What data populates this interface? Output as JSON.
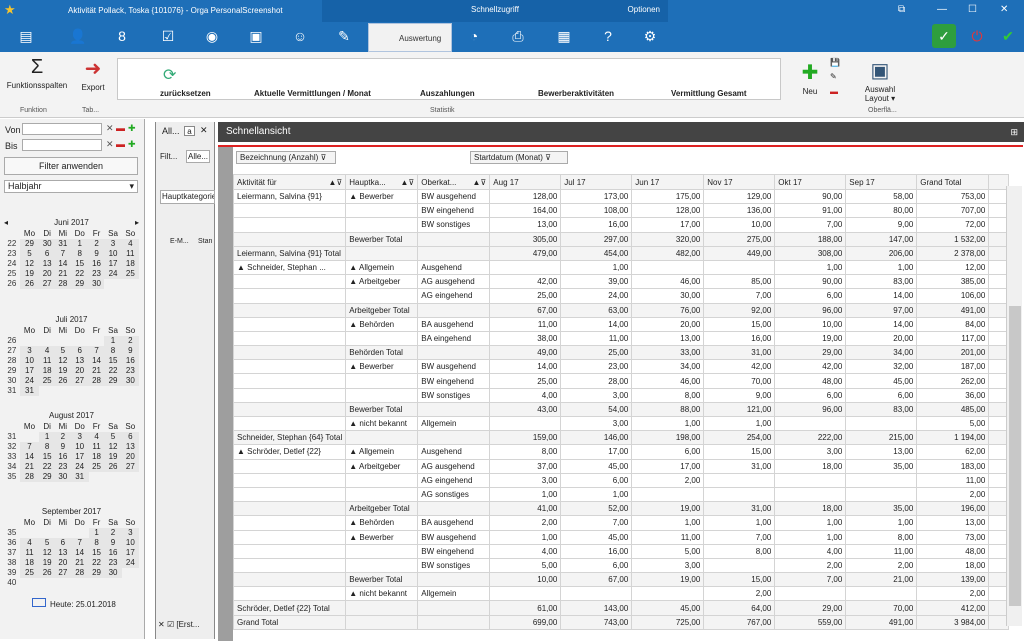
{
  "title": "Aktivität Pollack, Toska {101076} - Orga PersonalScreenshot",
  "quick": "Schnellzugriff",
  "options": "Optionen",
  "tab_active": "Auswertung",
  "ribbon": {
    "functions": "Funktionsspalten",
    "export": "Export",
    "grp_func": "Funktion",
    "grp_tab": "Tab...",
    "grp_stat": "Statistik",
    "grp_ober": "Oberflä...",
    "neu": "Neu",
    "auswahl_layout": "Auswahl\nLayout ▾",
    "stats": [
      "zurücksetzen",
      "Aktuelle Vermittlungen / Monat",
      "Auszahlungen",
      "Bewerberaktivitäten",
      "Vermittlung Gesamt"
    ]
  },
  "left": {
    "von": "Von",
    "bis": "Bis",
    "apply": "Filter anwenden",
    "period": "Halbjahr",
    "today": "Heute: 25.01.2018",
    "dow": [
      "Mo",
      "Di",
      "Mi",
      "Do",
      "Fr",
      "Sa",
      "So"
    ],
    "months": [
      {
        "name": "Juni 2017",
        "rows": [
          [
            "22",
            "29",
            "30",
            "31",
            "1",
            "2",
            "3",
            "4"
          ],
          [
            "23",
            "5",
            "6",
            "7",
            "8",
            "9",
            "10",
            "11"
          ],
          [
            "24",
            "12",
            "13",
            "14",
            "15",
            "16",
            "17",
            "18"
          ],
          [
            "25",
            "19",
            "20",
            "21",
            "22",
            "23",
            "24",
            "25"
          ],
          [
            "26",
            "26",
            "27",
            "28",
            "29",
            "30",
            "",
            ""
          ]
        ]
      },
      {
        "name": "Juli 2017",
        "rows": [
          [
            "26",
            "",
            "",
            "",
            "",
            "",
            "1",
            "2"
          ],
          [
            "27",
            "3",
            "4",
            "5",
            "6",
            "7",
            "8",
            "9"
          ],
          [
            "28",
            "10",
            "11",
            "12",
            "13",
            "14",
            "15",
            "16"
          ],
          [
            "29",
            "17",
            "18",
            "19",
            "20",
            "21",
            "22",
            "23"
          ],
          [
            "30",
            "24",
            "25",
            "26",
            "27",
            "28",
            "29",
            "30"
          ],
          [
            "31",
            "31",
            "",
            "",
            "",
            "",
            "",
            ""
          ]
        ]
      },
      {
        "name": "August 2017",
        "rows": [
          [
            "31",
            "",
            "1",
            "2",
            "3",
            "4",
            "5",
            "6"
          ],
          [
            "32",
            "7",
            "8",
            "9",
            "10",
            "11",
            "12",
            "13"
          ],
          [
            "33",
            "14",
            "15",
            "16",
            "17",
            "18",
            "19",
            "20"
          ],
          [
            "34",
            "21",
            "22",
            "23",
            "24",
            "25",
            "26",
            "27"
          ],
          [
            "35",
            "28",
            "29",
            "30",
            "31",
            "",
            "",
            ""
          ]
        ]
      },
      {
        "name": "September 2017",
        "rows": [
          [
            "35",
            "",
            "",
            "",
            "",
            "1",
            "2",
            "3"
          ],
          [
            "36",
            "4",
            "5",
            "6",
            "7",
            "8",
            "9",
            "10"
          ],
          [
            "37",
            "11",
            "12",
            "13",
            "14",
            "15",
            "16",
            "17"
          ],
          [
            "38",
            "18",
            "19",
            "20",
            "21",
            "22",
            "23",
            "24"
          ],
          [
            "39",
            "25",
            "26",
            "27",
            "28",
            "29",
            "30",
            ""
          ],
          [
            "40",
            "",
            "",
            "",
            "",
            "",
            "",
            ""
          ]
        ]
      }
    ]
  },
  "mid": {
    "tab1": "All...",
    "tab2": "a",
    "filt": "Filt...",
    "alle": "Alle...",
    "haupt": "Hauptkategorie",
    "emh": "E-M...",
    "stan": "Stan",
    "erst": "[Erst..."
  },
  "main": {
    "header": "Schnellansicht",
    "filter1": "Bezeichnung (Anzahl)",
    "filter2": "Startdatum (Monat)",
    "cols": [
      "Aktivität für",
      "Hauptka...",
      "Oberkat...",
      "Aug 17",
      "Jul 17",
      "Jun 17",
      "Nov 17",
      "Okt 17",
      "Sep 17",
      "Grand Total"
    ],
    "rows": [
      [
        "Leiermann, Salvina {91}",
        "▲ Bewerber",
        "BW ausgehend",
        "128,00",
        "173,00",
        "175,00",
        "129,00",
        "90,00",
        "58,00",
        "753,00"
      ],
      [
        "",
        "",
        "BW eingehend",
        "164,00",
        "108,00",
        "128,00",
        "136,00",
        "91,00",
        "80,00",
        "707,00"
      ],
      [
        "",
        "",
        "BW sonstiges",
        "13,00",
        "16,00",
        "17,00",
        "10,00",
        "7,00",
        "9,00",
        "72,00"
      ],
      [
        "",
        "Bewerber Total",
        "",
        "305,00",
        "297,00",
        "320,00",
        "275,00",
        "188,00",
        "147,00",
        "1 532,00"
      ],
      [
        "Leiermann, Salvina {91} Total",
        "",
        "",
        "479,00",
        "454,00",
        "482,00",
        "449,00",
        "308,00",
        "206,00",
        "2 378,00"
      ],
      [
        "▲ Schneider, Stephan ...",
        "▲ Allgemein",
        "Ausgehend",
        "",
        "1,00",
        "",
        "",
        "1,00",
        "1,00",
        "12,00"
      ],
      [
        "",
        "▲ Arbeitgeber",
        "AG ausgehend",
        "42,00",
        "39,00",
        "46,00",
        "85,00",
        "90,00",
        "83,00",
        "385,00"
      ],
      [
        "",
        "",
        "AG eingehend",
        "25,00",
        "24,00",
        "30,00",
        "7,00",
        "6,00",
        "14,00",
        "106,00"
      ],
      [
        "",
        "Arbeitgeber Total",
        "",
        "67,00",
        "63,00",
        "76,00",
        "92,00",
        "96,00",
        "97,00",
        "491,00"
      ],
      [
        "",
        "▲ Behörden",
        "BA ausgehend",
        "11,00",
        "14,00",
        "20,00",
        "15,00",
        "10,00",
        "14,00",
        "84,00"
      ],
      [
        "",
        "",
        "BA eingehend",
        "38,00",
        "11,00",
        "13,00",
        "16,00",
        "19,00",
        "20,00",
        "117,00"
      ],
      [
        "",
        "Behörden Total",
        "",
        "49,00",
        "25,00",
        "33,00",
        "31,00",
        "29,00",
        "34,00",
        "201,00"
      ],
      [
        "",
        "▲ Bewerber",
        "BW ausgehend",
        "14,00",
        "23,00",
        "34,00",
        "42,00",
        "42,00",
        "32,00",
        "187,00"
      ],
      [
        "",
        "",
        "BW eingehend",
        "25,00",
        "28,00",
        "46,00",
        "70,00",
        "48,00",
        "45,00",
        "262,00"
      ],
      [
        "",
        "",
        "BW sonstiges",
        "4,00",
        "3,00",
        "8,00",
        "9,00",
        "6,00",
        "6,00",
        "36,00"
      ],
      [
        "",
        "Bewerber Total",
        "",
        "43,00",
        "54,00",
        "88,00",
        "121,00",
        "96,00",
        "83,00",
        "485,00"
      ],
      [
        "",
        "▲ nicht bekannt",
        "Allgemein",
        "",
        "3,00",
        "1,00",
        "1,00",
        "",
        "",
        "5,00"
      ],
      [
        "Schneider, Stephan {64} Total",
        "",
        "",
        "159,00",
        "146,00",
        "198,00",
        "254,00",
        "222,00",
        "215,00",
        "1 194,00"
      ],
      [
        "▲ Schröder, Detlef {22}",
        "▲ Allgemein",
        "Ausgehend",
        "8,00",
        "17,00",
        "6,00",
        "15,00",
        "3,00",
        "13,00",
        "62,00"
      ],
      [
        "",
        "▲ Arbeitgeber",
        "AG ausgehend",
        "37,00",
        "45,00",
        "17,00",
        "31,00",
        "18,00",
        "35,00",
        "183,00"
      ],
      [
        "",
        "",
        "AG eingehend",
        "3,00",
        "6,00",
        "2,00",
        "",
        "",
        "",
        "11,00"
      ],
      [
        "",
        "",
        "AG sonstiges",
        "1,00",
        "1,00",
        "",
        "",
        "",
        "",
        "2,00"
      ],
      [
        "",
        "Arbeitgeber Total",
        "",
        "41,00",
        "52,00",
        "19,00",
        "31,00",
        "18,00",
        "35,00",
        "196,00"
      ],
      [
        "",
        "▲ Behörden",
        "BA ausgehend",
        "2,00",
        "7,00",
        "1,00",
        "1,00",
        "1,00",
        "1,00",
        "13,00"
      ],
      [
        "",
        "▲ Bewerber",
        "BW ausgehend",
        "1,00",
        "45,00",
        "11,00",
        "7,00",
        "1,00",
        "8,00",
        "73,00"
      ],
      [
        "",
        "",
        "BW eingehend",
        "4,00",
        "16,00",
        "5,00",
        "8,00",
        "4,00",
        "11,00",
        "48,00"
      ],
      [
        "",
        "",
        "BW sonstiges",
        "5,00",
        "6,00",
        "3,00",
        "",
        "2,00",
        "2,00",
        "18,00"
      ],
      [
        "",
        "Bewerber Total",
        "",
        "10,00",
        "67,00",
        "19,00",
        "15,00",
        "7,00",
        "21,00",
        "139,00"
      ],
      [
        "",
        "▲ nicht bekannt",
        "Allgemein",
        "",
        "",
        "",
        "2,00",
        "",
        "",
        "2,00"
      ],
      [
        "Schröder, Detlef {22} Total",
        "",
        "",
        "61,00",
        "143,00",
        "45,00",
        "64,00",
        "29,00",
        "70,00",
        "412,00"
      ],
      [
        "Grand Total",
        "",
        "",
        "699,00",
        "743,00",
        "725,00",
        "767,00",
        "559,00",
        "491,00",
        "3 984,00"
      ]
    ]
  }
}
